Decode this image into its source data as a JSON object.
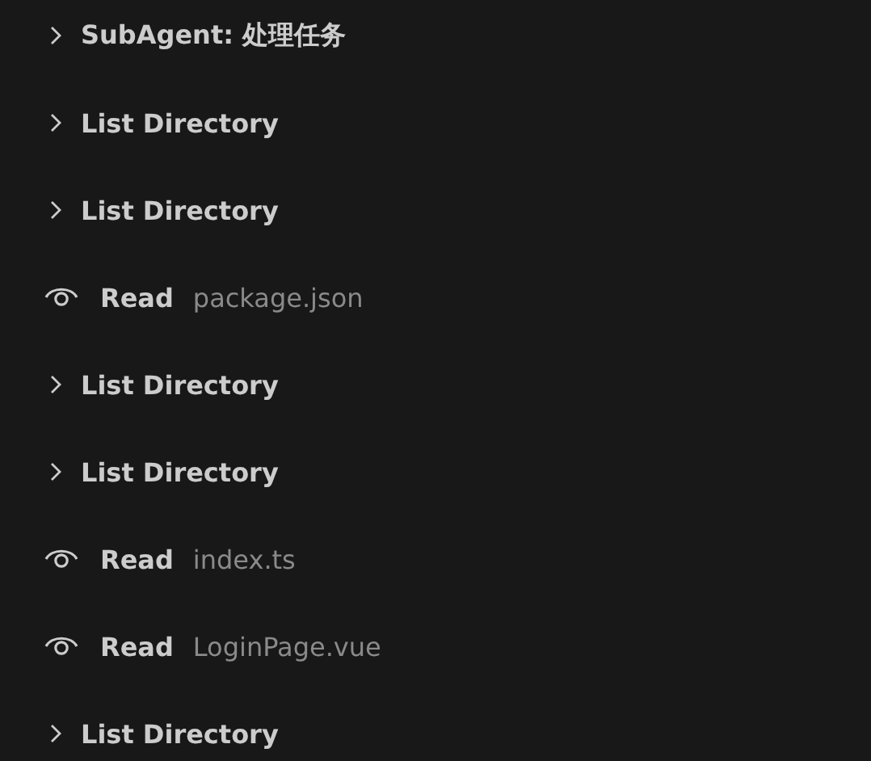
{
  "items": [
    {
      "kind": "group",
      "label": "SubAgent: 处理任务",
      "expanded": false
    },
    {
      "kind": "group",
      "label": "List Directory",
      "expanded": false
    },
    {
      "kind": "group",
      "label": "List Directory",
      "expanded": false
    },
    {
      "kind": "read",
      "label": "Read",
      "file": "package.json"
    },
    {
      "kind": "group",
      "label": "List Directory",
      "expanded": false
    },
    {
      "kind": "group",
      "label": "List Directory",
      "expanded": false
    },
    {
      "kind": "read",
      "label": "Read",
      "file": "index.ts"
    },
    {
      "kind": "read",
      "label": "Read",
      "file": "LoginPage.vue"
    },
    {
      "kind": "group",
      "label": "List Directory",
      "expanded": false
    }
  ]
}
